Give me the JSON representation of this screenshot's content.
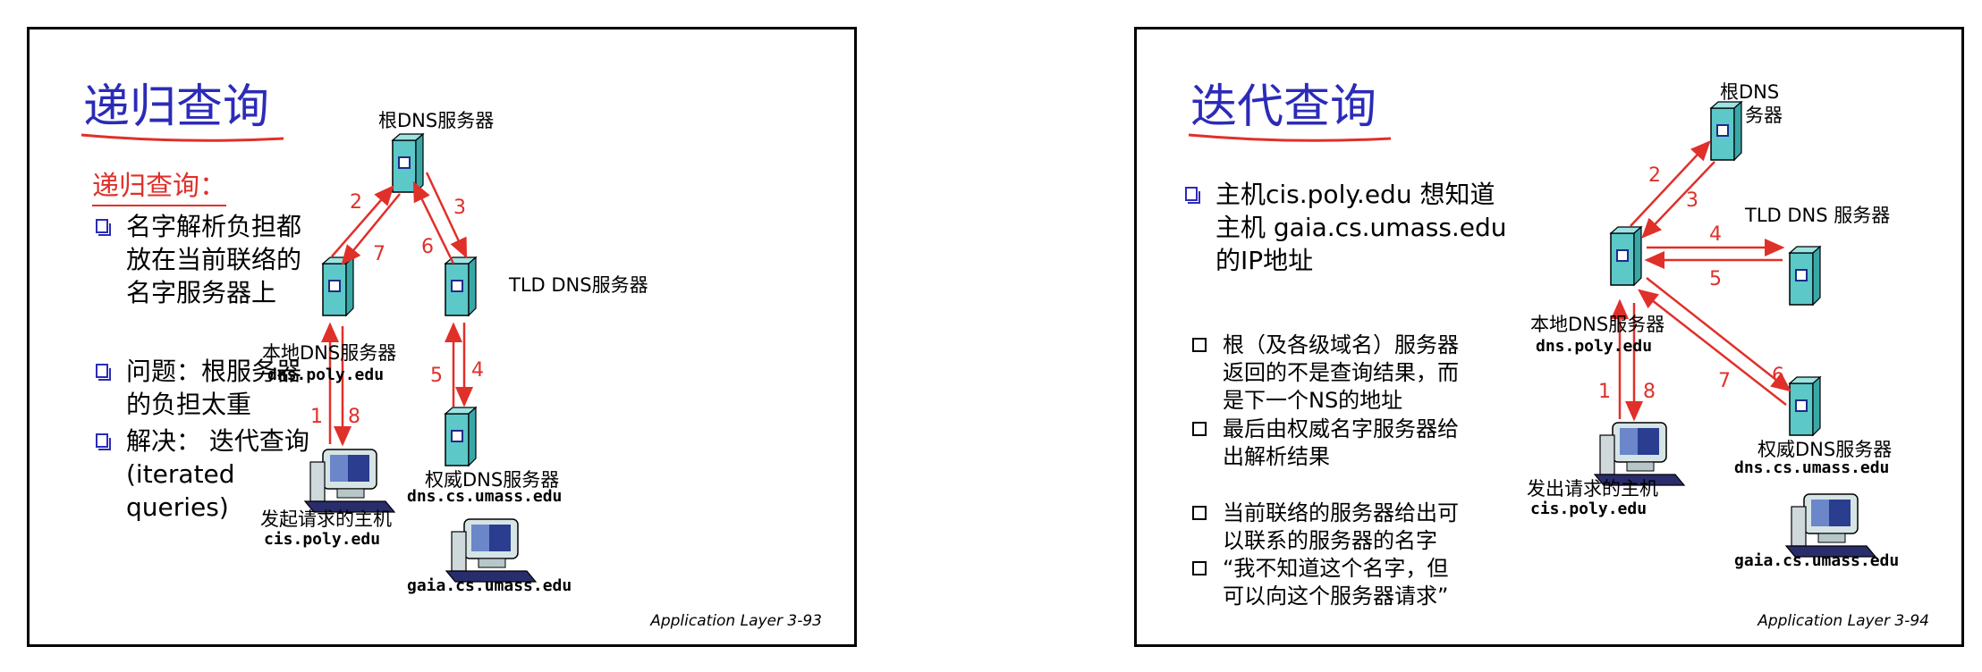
{
  "left": {
    "title": "递归查询",
    "subtitle": "递归查询：",
    "bullets": [
      [
        "名字解析负担都",
        "放在当前联络的",
        "名字服务器上"
      ],
      [
        "问题：根服务器",
        "的负担太重"
      ],
      [
        "解决： 迭代查询",
        "(iterated",
        "queries)"
      ]
    ],
    "labels": {
      "root": "根DNS服务器",
      "tld": "TLD DNS服务器",
      "local": "本地DNS服务器",
      "local_host": "dns.poly.edu",
      "auth": "权威DNS服务器",
      "auth_host": "dns.cs.umass.edu",
      "requester": "发起请求的主机",
      "requester_host": "cis.poly.edu",
      "target_host": "gaia.cs.umass.edu"
    },
    "steps": [
      "1",
      "2",
      "3",
      "4",
      "5",
      "6",
      "7",
      "8"
    ],
    "footer": "Application Layer   3-93"
  },
  "right": {
    "title": "迭代查询",
    "main_bullet": [
      "主机cis.poly.edu 想知道",
      "主机 gaia.cs.umass.edu",
      "的IP地址"
    ],
    "bullets": [
      [
        "根（及各级域名）服务器",
        "返回的不是查询结果，而",
        "是下一个NS的地址"
      ],
      [
        "最后由权威名字服务器给",
        "出解析结果"
      ],
      [
        "当前联络的服务器给出可",
        "以联系的服务器的名字"
      ],
      [
        "“我不知道这个名字，但",
        "可以向这个服务器请求”"
      ]
    ],
    "labels": {
      "root_line1": "根DNS",
      "root_line2": "务器",
      "tld": "TLD DNS 服务器",
      "local": "本地DNS服务器",
      "local_host": "dns.poly.edu",
      "requester": "发出请求的主机",
      "requester_host": "cis.poly.edu",
      "auth": "权威DNS服务器",
      "auth_host": "dns.cs.umass.edu",
      "target_host": "gaia.cs.umass.edu"
    },
    "steps": [
      "1",
      "2",
      "3",
      "4",
      "5",
      "6",
      "7",
      "8"
    ],
    "footer": "Application Layer   3-94"
  },
  "colors": {
    "title": "#2b2bb8",
    "accent_red": "#e0302a",
    "server": "#5cc8c8"
  }
}
